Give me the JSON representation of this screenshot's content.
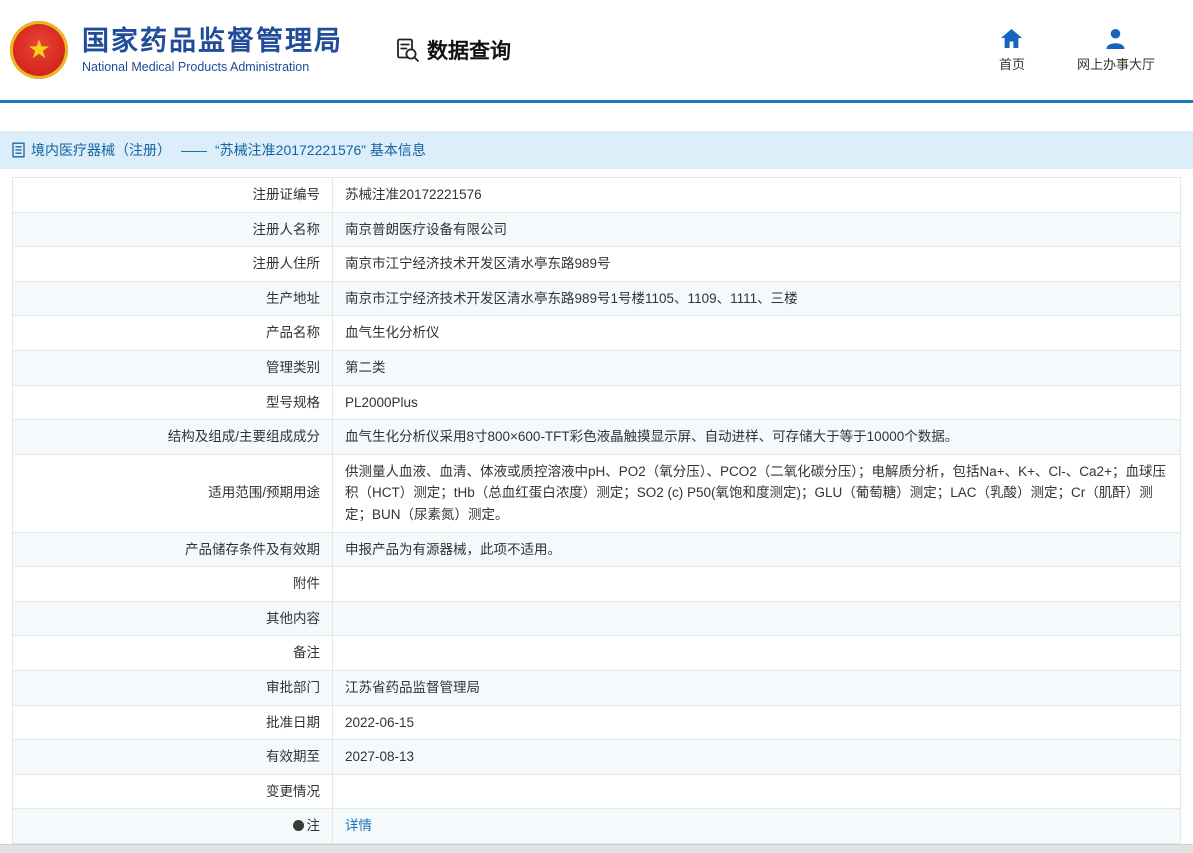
{
  "header": {
    "org_name_cn": "国家药品监督管理局",
    "org_name_en": "National Medical Products Administration",
    "query_title": "数据查询",
    "nav_home": "首页",
    "nav_hall": "网上办事大厅"
  },
  "breadcrumb": {
    "category": "境内医疗器械（注册）",
    "separator": "——",
    "title": "“苏械注准20172221576” 基本信息"
  },
  "colors": {
    "accent_blue": "#1878be",
    "title_bar_bg": "#dceef9",
    "title_blue": "#1464a0",
    "link_blue": "#1b75bb",
    "brand_blue": "#204c9a",
    "alt_row_bg": "#f4f9fc",
    "emblem_red": "#d6281e",
    "emblem_gold": "#f7d117",
    "nav_icon_blue": "#1565c0"
  },
  "table": {
    "rows": [
      {
        "label": "注册证编号",
        "value": "苏械注准20172221576"
      },
      {
        "label": "注册人名称",
        "value": "南京普朗医疗设备有限公司"
      },
      {
        "label": "注册人住所",
        "value": "南京市江宁经济技术开发区清水亭东路989号"
      },
      {
        "label": "生产地址",
        "value": "南京市江宁经济技术开发区清水亭东路989号1号楼1105、1109、1111、三楼"
      },
      {
        "label": "产品名称",
        "value": "血气生化分析仪"
      },
      {
        "label": "管理类别",
        "value": "第二类"
      },
      {
        "label": "型号规格",
        "value": "PL2000Plus"
      },
      {
        "label": "结构及组成/主要组成成分",
        "value": "血气生化分析仪采用8寸800×600-TFT彩色液晶触摸显示屏、自动进样、可存储大于等于10000个数据。"
      },
      {
        "label": "适用范围/预期用途",
        "value": "供测量人血液、血清、体液或质控溶液中pH、PO2（氧分压）、PCO2（二氧化碳分压）；电解质分析，包括Na+、K+、Cl-、Ca2+；血球压积（HCT）测定；tHb（总血红蛋白浓度）测定；SO2 (c) P50(氧饱和度测定)；GLU（葡萄糖）测定；LAC（乳酸）测定；Cr（肌酐）测定；BUN（尿素氮）测定。"
      },
      {
        "label": "产品储存条件及有效期",
        "value": "申报产品为有源器械，此项不适用。"
      },
      {
        "label": "附件",
        "value": ""
      },
      {
        "label": "其他内容",
        "value": ""
      },
      {
        "label": "备注",
        "value": ""
      },
      {
        "label": "审批部门",
        "value": "江苏省药品监督管理局"
      },
      {
        "label": "批准日期",
        "value": "2022-06-15"
      },
      {
        "label": "有效期至",
        "value": "2027-08-13"
      },
      {
        "label": "变更情况",
        "value": ""
      },
      {
        "label": "注",
        "icon": "note-dot-icon",
        "value": "详情",
        "is_link": true
      }
    ]
  }
}
